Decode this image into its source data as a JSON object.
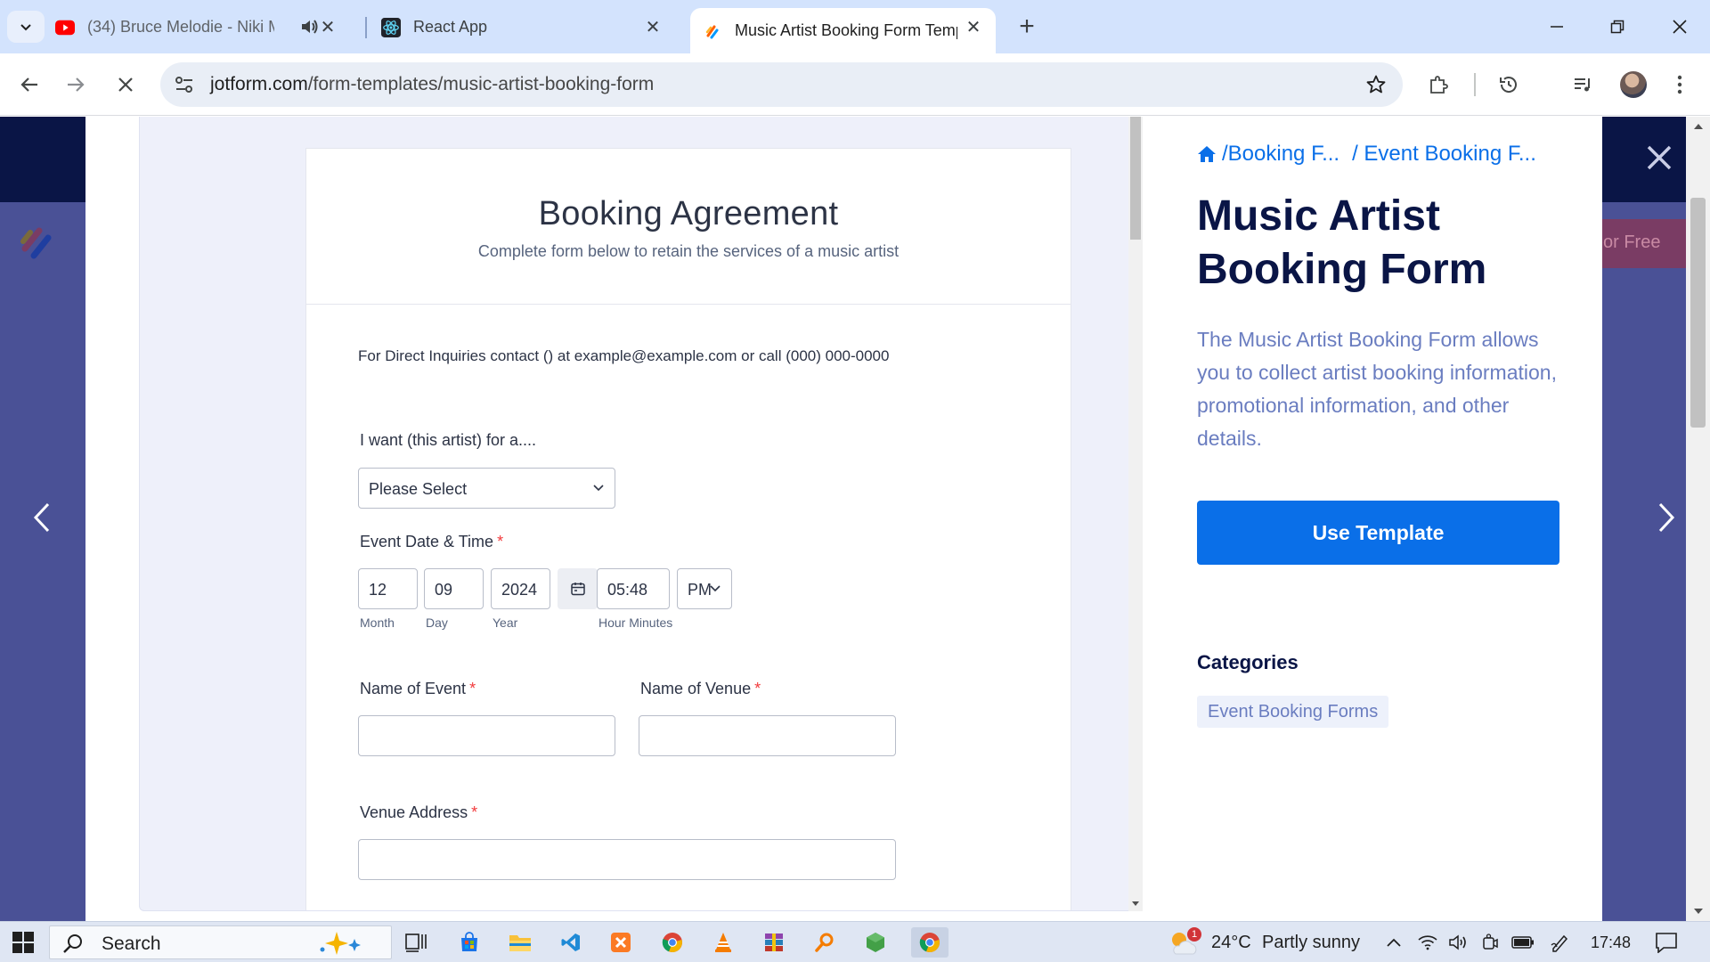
{
  "browser": {
    "tabs": [
      {
        "title": "(34) Bruce Melodie - Niki M",
        "favicon": "youtube-icon",
        "audio": "speaker-icon"
      },
      {
        "title": "React App",
        "favicon": "react-icon"
      },
      {
        "title": "Music Artist Booking Form Temp",
        "favicon": "jotform-icon",
        "active": true
      }
    ],
    "url_domain": "jotform.com",
    "url_path": "/form-templates/music-artist-booking-form"
  },
  "form": {
    "title": "Booking Agreement",
    "subtitle": "Complete form below to retain the services of a music artist",
    "inquiries": "For Direct Inquiries contact () at example@example.com or call (000) 000-0000",
    "want_label": "I want (this artist) for a....",
    "want_select": "Please Select",
    "date_label": "Event Date & Time",
    "required_mark": "*",
    "month_value": "12",
    "day_value": "09",
    "year_value": "2024",
    "time_value": "05:48",
    "ampm_value": "PM",
    "month_sub": "Month",
    "day_sub": "Day",
    "year_sub": "Year",
    "time_sub": "Hour Minutes",
    "event_name_label": "Name of Event",
    "venue_name_label": "Name of Venue",
    "venue_address_label": "Venue Address"
  },
  "side": {
    "crumb_1": "/Booking F...",
    "crumb_2": "/ Event Booking F...",
    "title": "Music Artist Booking Form",
    "description": "The Music Artist Booking Form allows you to collect artist booking information, promotional information, and other details.",
    "use_template": "Use Template",
    "categories_title": "Categories",
    "category_tag": "Event Booking Forms"
  },
  "background": {
    "free_text": "or Free"
  },
  "taskbar": {
    "search": "Search",
    "temperature": "24°C",
    "weather": "Partly sunny",
    "weather_badge": "1",
    "time": "17:48"
  },
  "colors": {
    "primary_blue": "#0a6fe8",
    "navy": "#0a1546",
    "required_red": "#f23a3c"
  }
}
